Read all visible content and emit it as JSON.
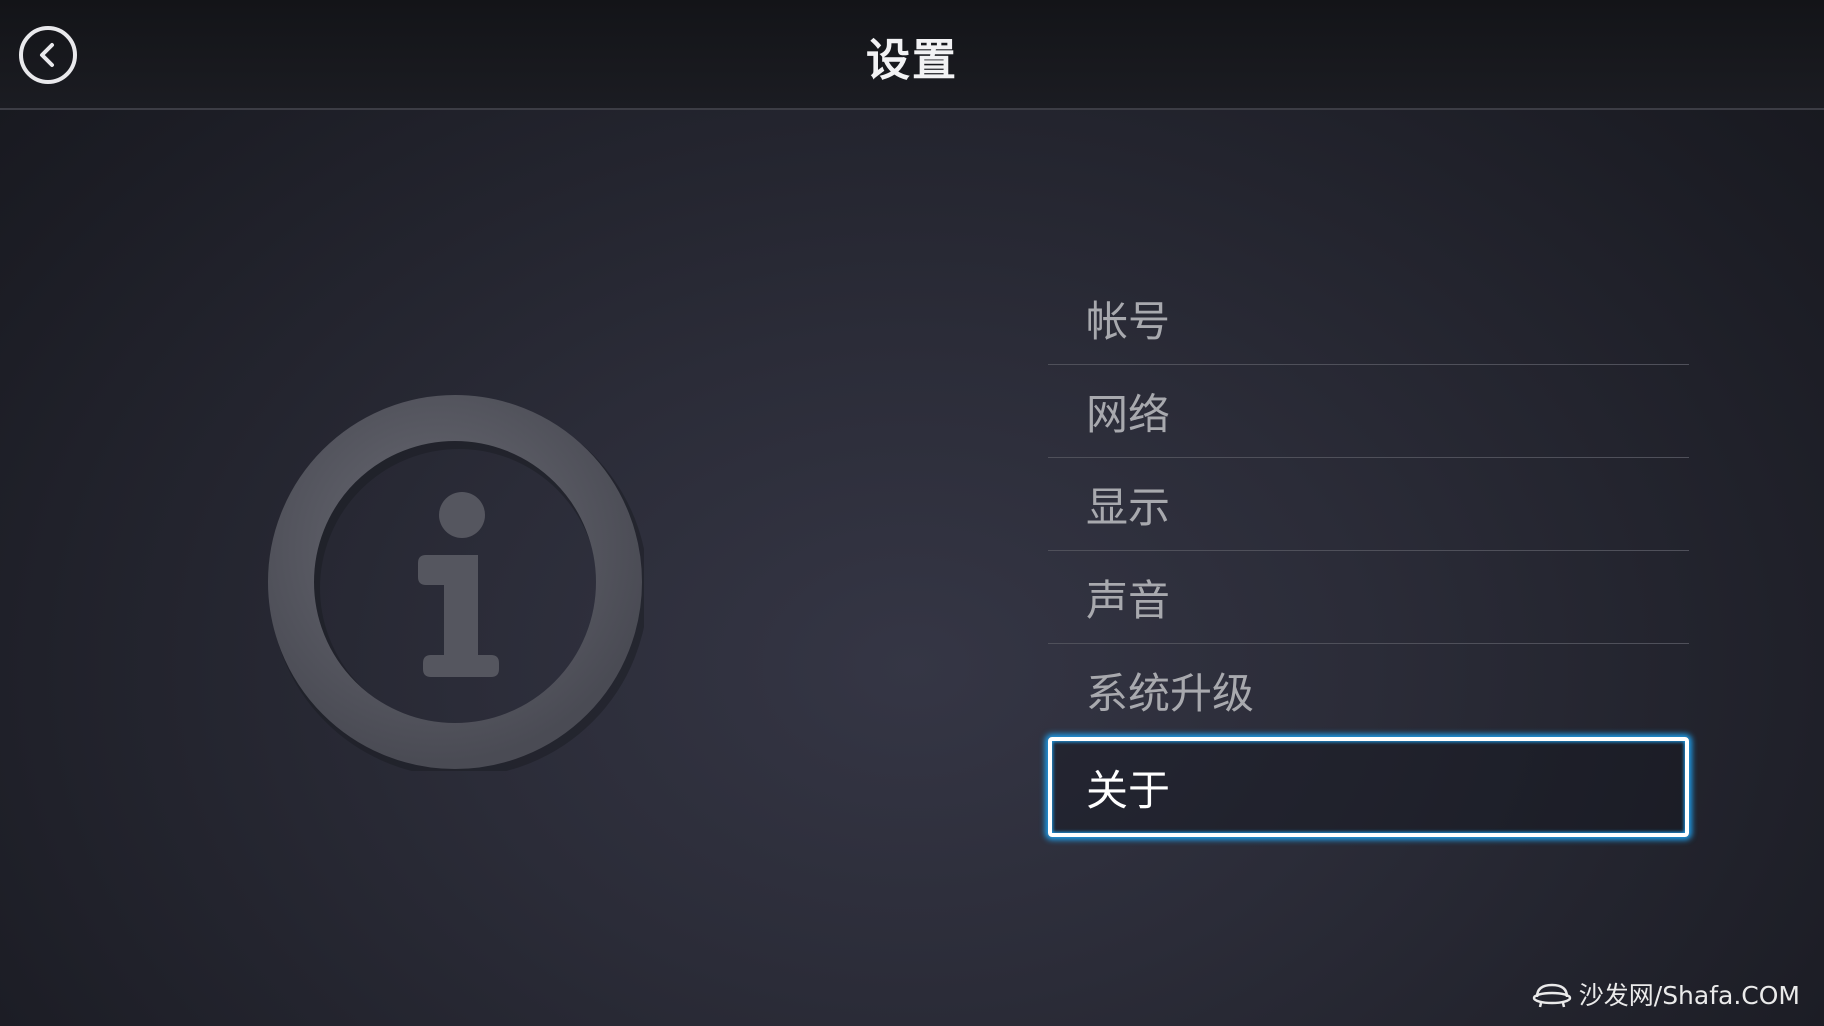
{
  "header": {
    "title": "设置",
    "back_icon": "chevron-left-icon"
  },
  "illustration": {
    "icon": "info-icon"
  },
  "menu": {
    "items": [
      {
        "label": "帐号",
        "selected": false
      },
      {
        "label": "网络",
        "selected": false
      },
      {
        "label": "显示",
        "selected": false
      },
      {
        "label": "声音",
        "selected": false
      },
      {
        "label": "系统升级",
        "selected": false
      },
      {
        "label": "关于",
        "selected": true
      }
    ]
  },
  "watermark": {
    "text": "沙发网/Shafa.COM",
    "icon": "sofa-logo-icon"
  },
  "colors": {
    "focus_glow": "#1f9be6",
    "text_inactive": "#a8a9ae",
    "text_active": "#ffffff"
  }
}
